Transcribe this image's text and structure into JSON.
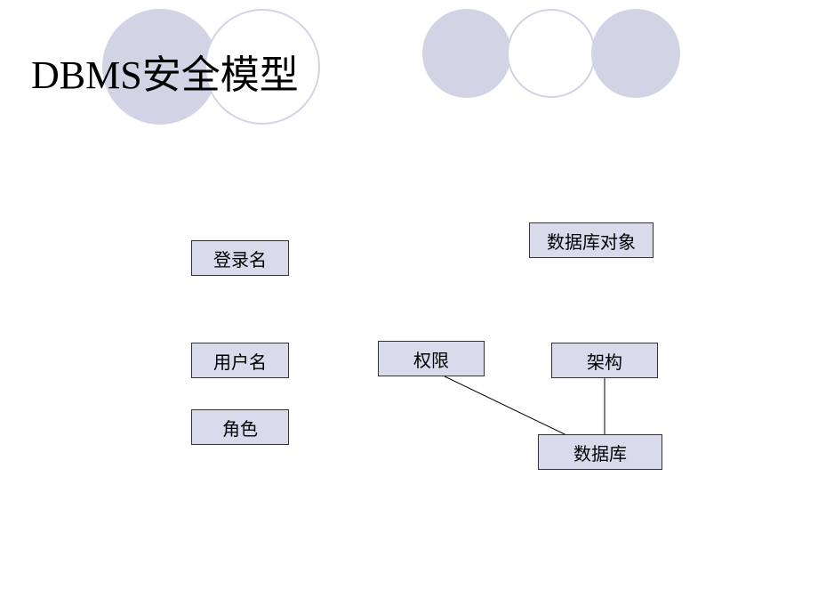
{
  "title": "DBMS安全模型",
  "boxes": {
    "login_name": "登录名",
    "database_object": "数据库对象",
    "user_name": "用户名",
    "permission": "权限",
    "schema": "架构",
    "role": "角色",
    "database": "数据库"
  }
}
